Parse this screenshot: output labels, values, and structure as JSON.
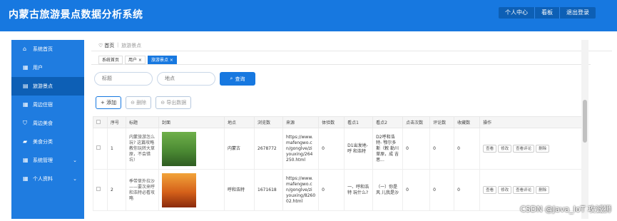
{
  "header": {
    "title": "内蒙古旅游景点数据分析系统",
    "buttons": [
      "个人中心",
      "看板",
      "退出登录"
    ]
  },
  "sidebar": {
    "items": [
      {
        "label": "系统首页",
        "icon": "home-icon",
        "active": false,
        "arrow": ""
      },
      {
        "label": "用户",
        "icon": "grid-icon",
        "active": false,
        "arrow": ""
      },
      {
        "label": "旅游景点",
        "icon": "list-icon",
        "active": true,
        "arrow": ""
      },
      {
        "label": "周边住宿",
        "icon": "grid-icon",
        "active": false,
        "arrow": ""
      },
      {
        "label": "周边美食",
        "icon": "shield-icon",
        "active": false,
        "arrow": ""
      },
      {
        "label": "美食分类",
        "icon": "folder-icon",
        "active": false,
        "arrow": ""
      },
      {
        "label": "系统管理",
        "icon": "grid-icon",
        "active": false,
        "arrow": "⌄"
      },
      {
        "label": "个人资料",
        "icon": "grid-icon",
        "active": false,
        "arrow": "⌄"
      }
    ]
  },
  "breadcrumb": {
    "home": "首页",
    "current": "旅游景点"
  },
  "tabs": [
    {
      "label": "系统首页",
      "active": false
    },
    {
      "label": "用户 ×",
      "active": false
    },
    {
      "label": "旅游景点 ×",
      "active": true
    }
  ],
  "search": {
    "title_placeholder": "标题",
    "location_placeholder": "地点",
    "query_label": "查询"
  },
  "actions": {
    "add": "+ 添加",
    "delete": "⊖ 删除",
    "export": "⊖ 导出数据"
  },
  "table": {
    "headers": [
      "",
      "序号",
      "标题",
      "封面",
      "地点",
      "浏览数",
      "来源",
      "体验数",
      "看点1",
      "看点2",
      "点击次数",
      "评论数",
      "收藏数",
      "操作"
    ],
    "rows": [
      {
        "index": "1",
        "title": "内蒙旅游怎么玩? 这篇攻略 教你玩转大草 原，不会错 坑!",
        "location": "内蒙古",
        "views": "2678772",
        "source": "https://www. mafengwo.c n/gonglve/zi youxing/264 250.html",
        "experience": "0",
        "point1": "D1出发地-呼 和浩特",
        "point2": "D2呼和浩特- 鄂尔多斯（敕 勒川草原，成 吉思...",
        "clicks": "0",
        "comments": "0",
        "favorites": "0",
        "ops": [
          "查看",
          "修改",
          "查看评论",
          "删除"
        ],
        "cover_colors": [
          "#6fb04a",
          "#4b8a33",
          "#2f5d22"
        ]
      },
      {
        "index": "2",
        "title": "季带草外拉沙 ——要次来呼 和浩特必看攻 略",
        "location": "呼和浩特",
        "views": "1671618",
        "source": "https://www. mafengwo.c n/gonglve/zi youxing/8260 02.html",
        "experience": "0",
        "point1": "一、呼和浩特 玩什么?",
        "point2": "（一）你是风 儿我是沙",
        "clicks": "0",
        "comments": "0",
        "favorites": "0",
        "ops": [
          "查看",
          "修改",
          "查看评论",
          "删除"
        ],
        "cover_colors": [
          "#f2a33a",
          "#d5611a",
          "#8a2a0c"
        ]
      }
    ]
  },
  "watermark": "CSDN @Java_IoT 攻诚狮"
}
